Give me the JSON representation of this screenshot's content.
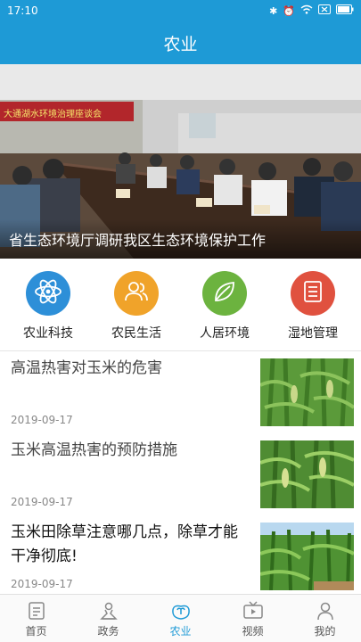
{
  "status": {
    "time": "17:10"
  },
  "appbar": {
    "title": "农业"
  },
  "banner": {
    "caption": "省生态环境厅调研我区生态环境保护工作",
    "sign_text": "大通湖水环境治理座谈会"
  },
  "categories": [
    {
      "label": "农业科技",
      "icon": "atom-icon",
      "color": "#2d8fd8"
    },
    {
      "label": "农民生活",
      "icon": "people-icon",
      "color": "#f0a32a"
    },
    {
      "label": "人居环境",
      "icon": "leaf-icon",
      "color": "#6cb33f"
    },
    {
      "label": "湿地管理",
      "icon": "document-icon",
      "color": "#e0513f"
    }
  ],
  "news": [
    {
      "title": "高温热害对玉米的危害",
      "date": "2019-09-17"
    },
    {
      "title": "玉米高温热害的预防措施",
      "date": "2019-09-17"
    },
    {
      "title": "玉米田除草注意哪几点，除草才能干净彻底!",
      "date": "2019-09-17"
    }
  ],
  "tabs": [
    {
      "label": "首页",
      "icon": "home-doc-icon"
    },
    {
      "label": "政务",
      "icon": "official-icon"
    },
    {
      "label": "农业",
      "icon": "sprout-icon",
      "active": true
    },
    {
      "label": "视频",
      "icon": "tv-icon"
    },
    {
      "label": "我的",
      "icon": "user-icon"
    }
  ],
  "colors": {
    "primary": "#1e9ad6",
    "tab_active": "#1e9ad6"
  }
}
